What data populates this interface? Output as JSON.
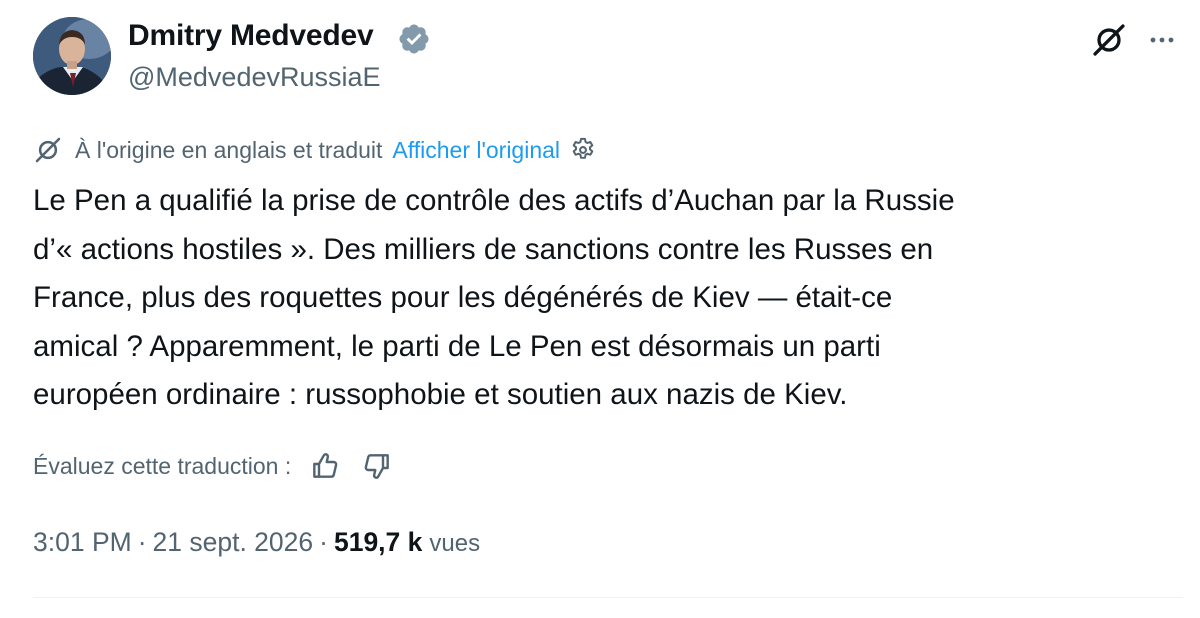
{
  "author": {
    "display_name": "Dmitry Medvedev",
    "handle": "@MedvedevRussiaE",
    "verified": true
  },
  "header_actions": {
    "grok_icon": "grok-slash-circle",
    "more_icon": "ellipsis-horizontal"
  },
  "translation": {
    "notice": "À l'origine en anglais et traduit",
    "show_original": "Afficher l'original",
    "settings_icon": "gear"
  },
  "tweet": {
    "lines": [
      "Le Pen a qualifié la prise de contrôle des actifs d’Auchan par la Russie",
      "d’« actions hostiles ». Des milliers de sanctions contre les Russes en",
      "France, plus des roquettes pour les dégénérés de Kiev — était-ce",
      "amical ? Apparemment, le parti de Le Pen est désormais un parti",
      "européen ordinaire : russophobie et soutien aux nazis de Kiev."
    ]
  },
  "rate_translation": {
    "label": "Évaluez cette traduction :",
    "thumb_up_icon": "thumbs-up",
    "thumb_down_icon": "thumbs-down"
  },
  "meta": {
    "time": "3:01 PM",
    "separator": "·",
    "date": "21 sept. 2026",
    "views_count": "519,7 k",
    "views_label": "vues"
  },
  "colors": {
    "text_primary": "#0f1419",
    "text_secondary": "#536471",
    "link": "#1d9bf0",
    "verified": "#829aab"
  }
}
